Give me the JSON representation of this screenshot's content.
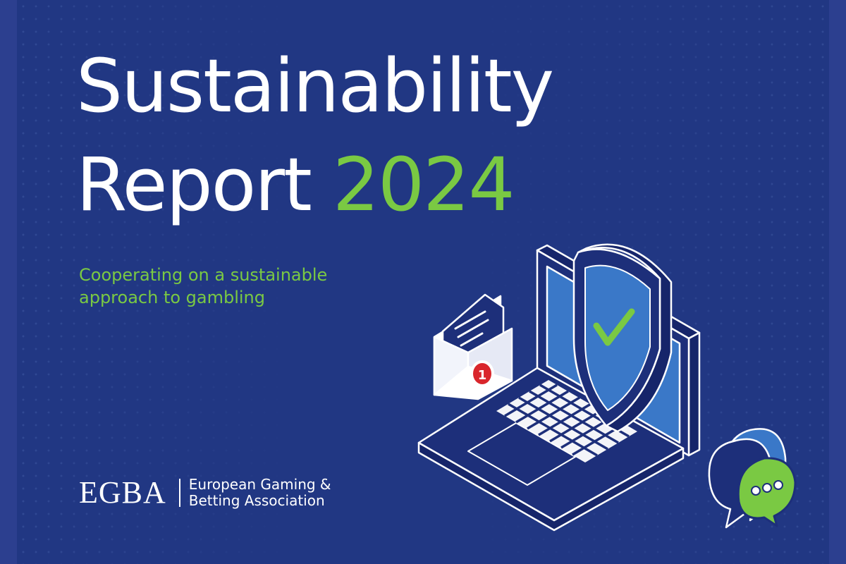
{
  "cover": {
    "title_line1": "Sustainability",
    "title_line2_word": "Report",
    "title_line2_year": "2024",
    "subtitle_line1": "Cooperating on a sustainable",
    "subtitle_line2": "approach to gambling",
    "org_logo": "EGBA",
    "org_name_line1": "European Gaming &",
    "org_name_line2": "Betting Association"
  },
  "illustration": {
    "notification_count": "1",
    "icons": [
      "laptop-icon",
      "shield-check-icon",
      "envelope-icon",
      "notification-badge-icon",
      "chat-bubble-icon"
    ]
  },
  "colors": {
    "background": "#213783",
    "accent_green": "#7ac943",
    "text_white": "#ffffff",
    "screen_blue": "#3a78c8",
    "badge_red": "#d9262c"
  }
}
